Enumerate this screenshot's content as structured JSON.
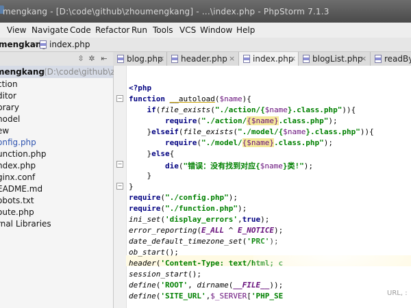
{
  "window": {
    "title": "mengkang - [D:\\code\\github\\zhoumengkang] - ...\\index.php - PhpStorm 7.1.3"
  },
  "menu": [
    "View",
    "Navigate",
    "Code",
    "Refactor",
    "Run",
    "Tools",
    "VCS",
    "Window",
    "Help"
  ],
  "breadcrumb": {
    "project": "mengkang",
    "file": "index.php"
  },
  "tabs": [
    {
      "label": "blog.php",
      "active": false
    },
    {
      "label": "header.php",
      "active": false
    },
    {
      "label": "index.php",
      "active": true
    },
    {
      "label": "blogList.php",
      "active": false
    },
    {
      "label": "readBy",
      "active": false
    }
  ],
  "project_tree": {
    "root_name": "mengkang",
    "root_path": "(D:\\code\\github\\zh",
    "items": [
      "ction",
      "ditor",
      "brary",
      "nodel",
      "ew",
      "onfig.php",
      "unction.php",
      "ndex.php",
      "ginx.conf",
      "EADME.md",
      "obots.txt",
      "oute.php",
      "rnal Libraries"
    ]
  },
  "editor": {
    "url_hint": "URL, :"
  },
  "colors": {
    "keyword": "#000080",
    "string": "#008000",
    "variable": "#660e7a",
    "highlight": "#f5e99a"
  }
}
